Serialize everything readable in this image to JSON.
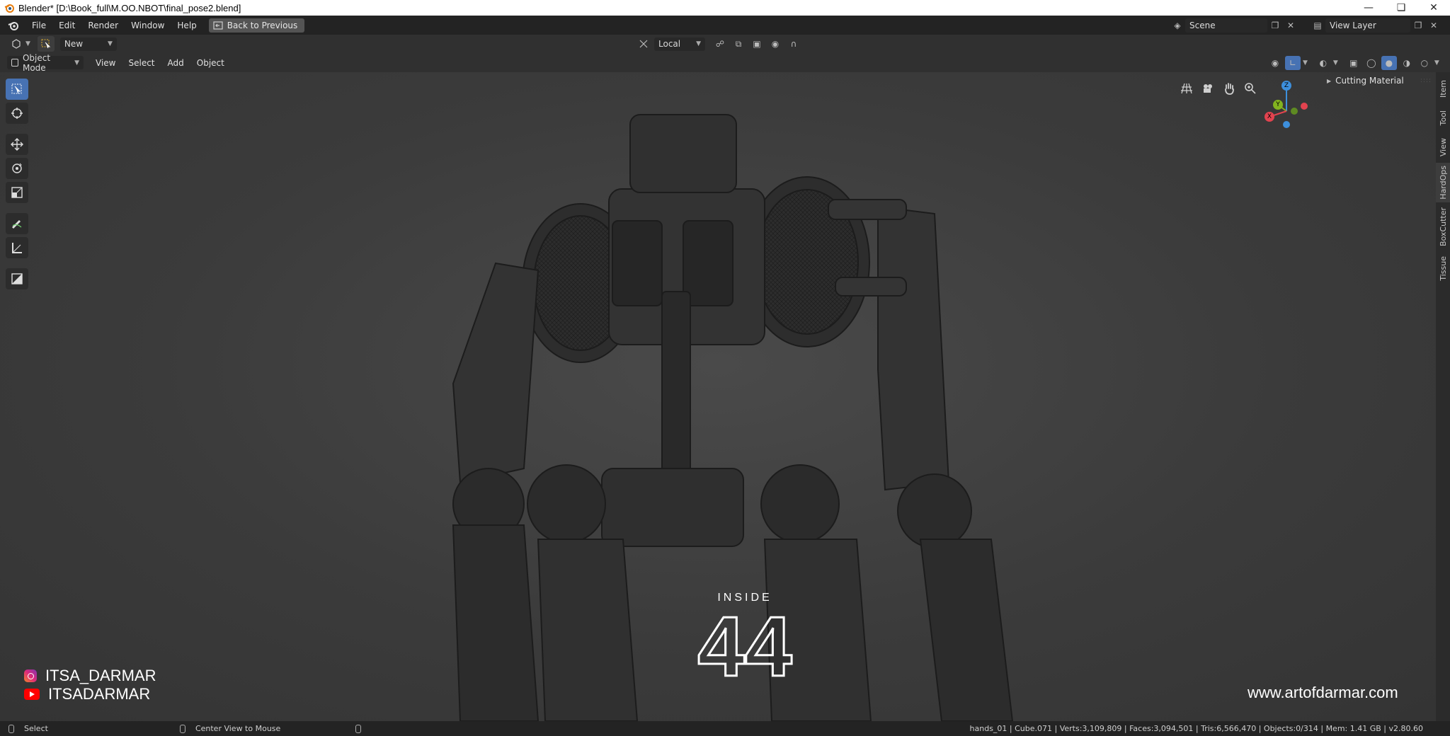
{
  "window": {
    "title": "Blender* [D:\\Book_full\\M.OO.NBOT\\final_pose2.blend]"
  },
  "menu": {
    "items": [
      "File",
      "Edit",
      "Render",
      "Window",
      "Help"
    ],
    "back_button": "Back to Previous"
  },
  "scene": {
    "label": "Scene"
  },
  "view_layer": {
    "label": "View Layer"
  },
  "header1": {
    "new_label": "New",
    "transform_orientation": "Local"
  },
  "header2": {
    "mode": "Object Mode",
    "menus": [
      "View",
      "Select",
      "Add",
      "Object"
    ]
  },
  "sidebar": {
    "panel_title": "Cutting Material",
    "tabs": [
      "Item",
      "Tool",
      "View",
      "HardOps",
      "BoxCutter",
      "Tissue"
    ],
    "active_tab": "HardOps"
  },
  "gizmo": {
    "z": "Z",
    "y": "Y",
    "x": "X"
  },
  "overlay": {
    "instagram": "ITSA_DARMAR",
    "youtube": "ITSADARMAR",
    "website": "www.artofdarmar.com",
    "logo_top": "INSIDE",
    "logo_number": "44"
  },
  "status": {
    "left_action": "Select",
    "middle_action": "Center View to Mouse",
    "stats": "hands_01 | Cube.071 | Verts:3,109,809 | Faces:3,094,501 | Tris:6,566,470 | Objects:0/314 | Mem: 1.41 GB | v2.80.60"
  },
  "colors": {
    "active_tool": "#4772b3",
    "axis_x": "#e2434f",
    "axis_y": "#82b31f",
    "axis_z": "#3d8fdc"
  }
}
